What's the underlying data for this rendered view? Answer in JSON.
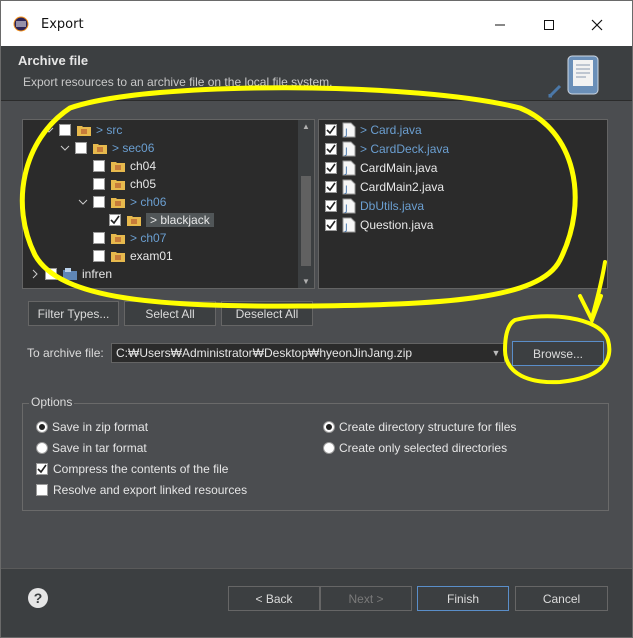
{
  "window": {
    "title": "Export"
  },
  "header": {
    "title": "Archive file",
    "description": "Export resources to an archive file on the local file system."
  },
  "tree": [
    {
      "label": "> src",
      "dim": true
    },
    {
      "label": "> sec06",
      "dim": true
    },
    {
      "label": "ch04",
      "dim": false
    },
    {
      "label": "ch05",
      "dim": false
    },
    {
      "label": "> ch06",
      "dim": true
    },
    {
      "label": "> blackjack",
      "dim": false
    },
    {
      "label": "> ch07",
      "dim": true
    },
    {
      "label": "exam01",
      "dim": false
    },
    {
      "label": "infren",
      "dim": false
    }
  ],
  "files": [
    {
      "label": "> Card.java",
      "dim": true
    },
    {
      "label": "> CardDeck.java",
      "dim": true
    },
    {
      "label": "CardMain.java",
      "dim": false
    },
    {
      "label": "CardMain2.java",
      "dim": false
    },
    {
      "label": "DbUtils.java",
      "dim": true
    },
    {
      "label": "Question.java",
      "dim": false
    }
  ],
  "buttons": {
    "filter_types": "Filter Types...",
    "select_all": "Select All",
    "deselect_all": "Deselect All",
    "browse": "Browse..."
  },
  "archive": {
    "label": "To archive file:",
    "value": "C:₩Users₩Administrator₩Desktop₩hyeonJinJang.zip"
  },
  "options": {
    "legend": "Options",
    "zip": "Save in zip format",
    "tar": "Save in tar format",
    "compress": "Compress the contents of the file",
    "resolve": "Resolve and export linked resources",
    "create_structure": "Create directory structure for files",
    "create_selected": "Create only selected directories"
  },
  "footer": {
    "help": "?",
    "back": "< Back",
    "next": "Next >",
    "finish": "Finish",
    "cancel": "Cancel"
  },
  "colors": {
    "annotation": "#ffff00",
    "dim_label": "#6b9fd1"
  }
}
